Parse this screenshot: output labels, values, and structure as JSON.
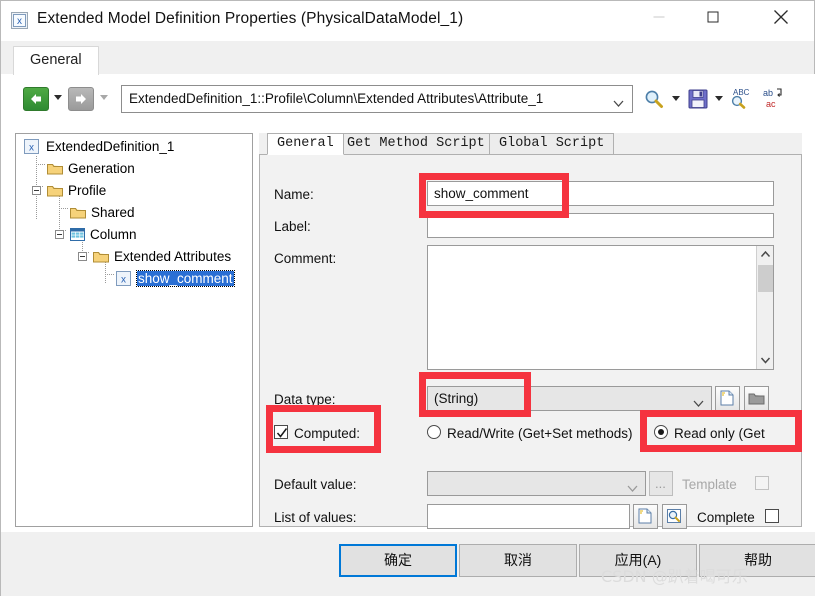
{
  "window": {
    "title": "Extended Model Definition Properties (PhysicalDataModel_1)",
    "icon": "document-x-icon",
    "controls": {
      "minimize": "minimize-icon",
      "maximize": "maximize-icon",
      "close": "close-icon"
    }
  },
  "outer_tabs": [
    {
      "label": "General",
      "active": true
    }
  ],
  "toolbar": {
    "back": "back-arrow-icon",
    "back_dropdown": "chevron-down-icon",
    "forward": "forward-arrow-icon",
    "forward_dropdown": "chevron-down-icon",
    "path_value": "ExtendedDefinition_1::Profile\\Column\\Extended Attributes\\Attribute_1",
    "path_dropdown": "chevron-down-icon",
    "find": "magnifier-icon",
    "find_dropdown": "chevron-down-icon",
    "save": "save-floppy-icon",
    "save_dropdown": "chevron-down-icon",
    "spellcheck": "spellcheck-abc-icon",
    "replace": "replace-ab-ac-icon"
  },
  "tree": [
    {
      "label": "ExtendedDefinition_1",
      "icon": "document-x-icon",
      "depth": 0,
      "expander": "collapse",
      "selected": false
    },
    {
      "label": "Generation",
      "icon": "folder-icon",
      "depth": 1,
      "expander": "none",
      "selected": false
    },
    {
      "label": "Profile",
      "icon": "folder-icon",
      "depth": 1,
      "expander": "collapse",
      "selected": false
    },
    {
      "label": "Shared",
      "icon": "folder-icon",
      "depth": 2,
      "expander": "none",
      "selected": false
    },
    {
      "label": "Column",
      "icon": "table-grid-icon",
      "depth": 2,
      "expander": "collapse",
      "selected": false
    },
    {
      "label": "Extended Attributes",
      "icon": "folder-icon",
      "depth": 3,
      "expander": "collapse",
      "selected": false
    },
    {
      "label": "show_comment",
      "icon": "document-x-icon",
      "depth": 4,
      "expander": "none",
      "selected": true
    }
  ],
  "inner_tabs": [
    {
      "label": "General",
      "active": true
    },
    {
      "label": "Get Method Script",
      "active": false
    },
    {
      "label": "Global Script",
      "active": false
    }
  ],
  "form": {
    "name": {
      "label": "Name:",
      "value": "show_comment",
      "placeholder": ""
    },
    "label_field": {
      "label": "Label:",
      "value": "",
      "placeholder": ""
    },
    "comment": {
      "label": "Comment:",
      "value": "",
      "placeholder": ""
    },
    "data_type": {
      "label": "Data type:",
      "value": "(String)",
      "dropdown": "chevron-down-icon",
      "disabled": true
    },
    "data_type_buttons": [
      {
        "name": "edit-datatype-button",
        "icon": "new-document-icon"
      },
      {
        "name": "browse-datatype-button",
        "icon": "folder-open-icon"
      }
    ],
    "computed": {
      "label": "Computed:",
      "checked": true
    },
    "access_radios": [
      {
        "label": "Read/Write (Get+Set methods)",
        "selected": false
      },
      {
        "label": "Read only (Get",
        "selected": true
      }
    ],
    "default_value": {
      "label": "Default value:",
      "value": "",
      "dropdown": "chevron-down-icon",
      "disabled": true,
      "browse": "..."
    },
    "template": {
      "label": "Template",
      "checked": false,
      "disabled": true
    },
    "list_of_values": {
      "label": "List of values:",
      "value": ""
    },
    "list_buttons": [
      {
        "name": "new-list-button",
        "icon": "new-document-icon"
      },
      {
        "name": "browse-list-button",
        "icon": "preview-icon"
      }
    ],
    "complete": {
      "label": "Complete",
      "checked": false
    }
  },
  "footer_buttons": [
    {
      "label": "确定",
      "name": "ok-button",
      "default": true
    },
    {
      "label": "取消",
      "name": "cancel-button",
      "default": false
    },
    {
      "label": "应用(A)",
      "name": "apply-button",
      "default": false
    },
    {
      "label": "帮助",
      "name": "help-button",
      "default": false
    }
  ],
  "watermark": "CSDN @趴着喝可乐",
  "annotations": {
    "color": "#f5333f",
    "boxes": [
      {
        "name": "name-field-highlight"
      },
      {
        "name": "data-type-highlight"
      },
      {
        "name": "computed-highlight"
      },
      {
        "name": "read-only-highlight"
      }
    ]
  }
}
